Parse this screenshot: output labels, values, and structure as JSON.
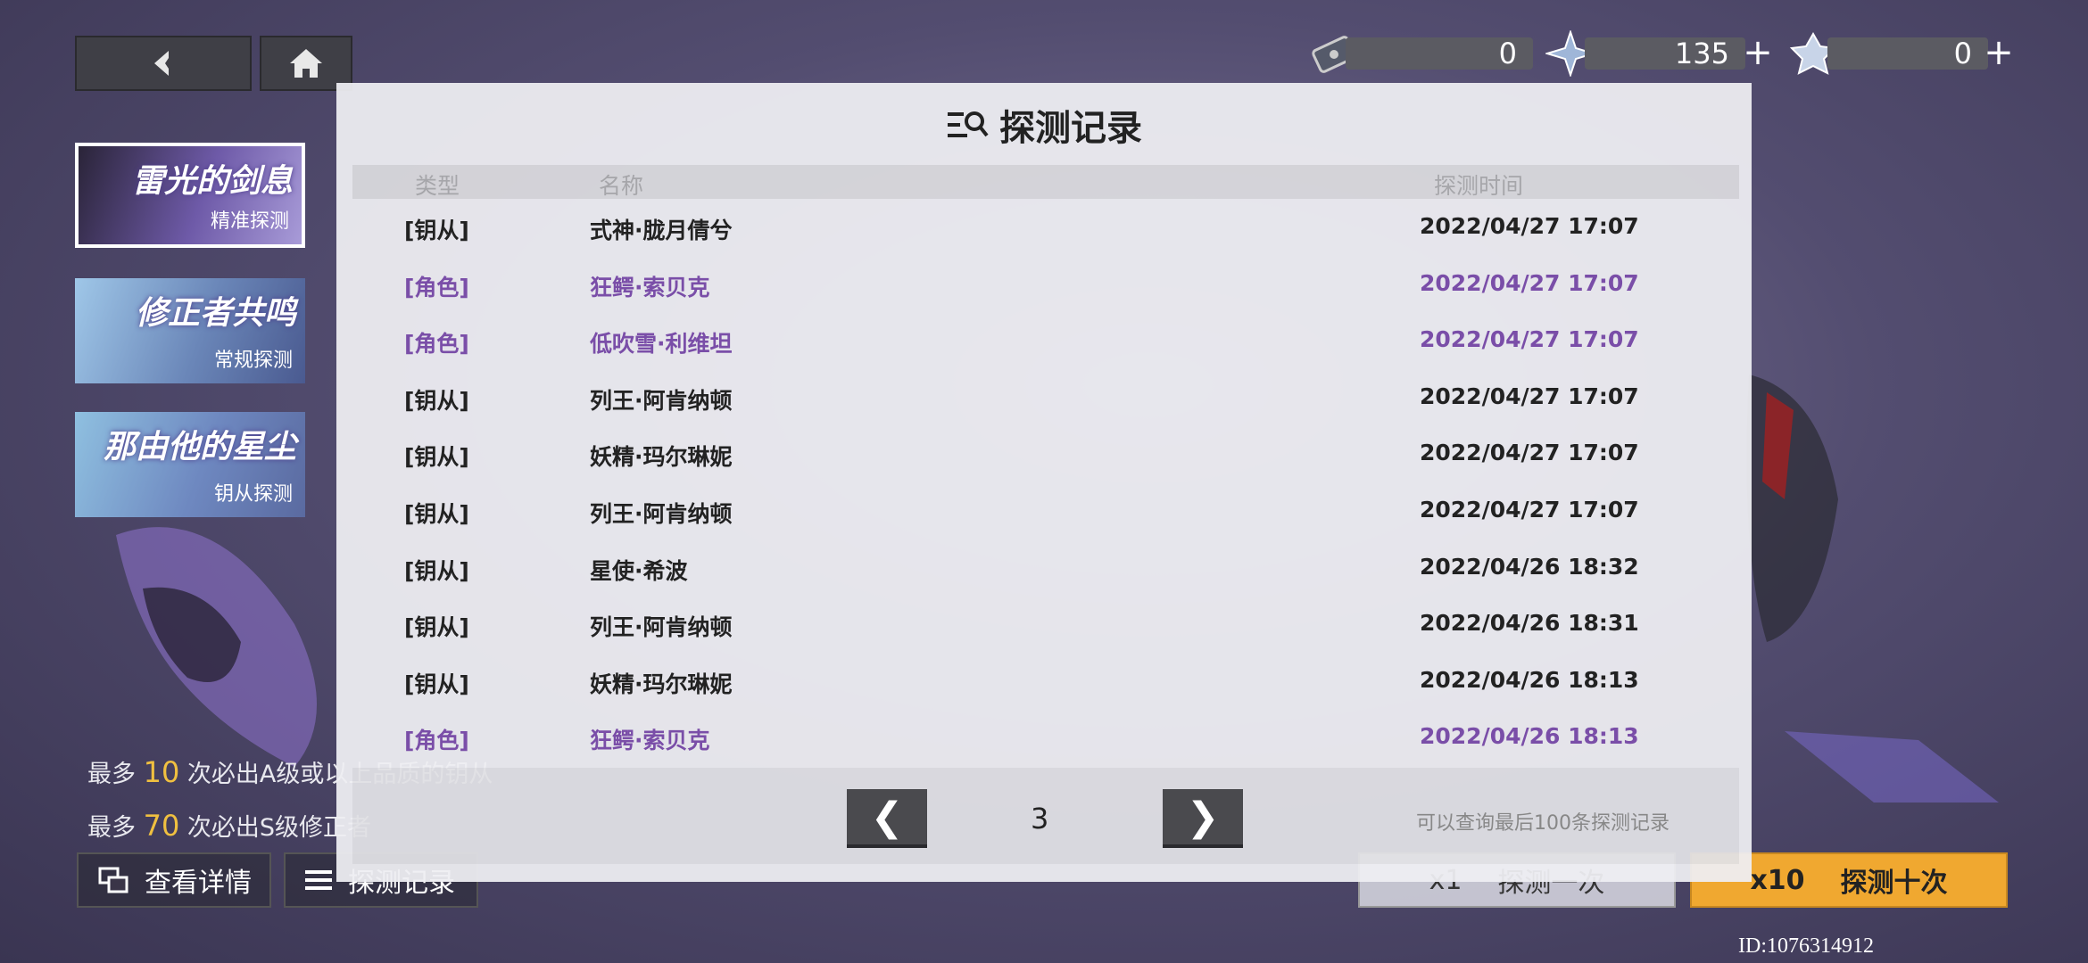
{
  "resources": [
    {
      "value": "0",
      "plus": ""
    },
    {
      "value": "135",
      "plus": "+"
    },
    {
      "value": "0",
      "plus": "+"
    }
  ],
  "banners": [
    {
      "title": "雷光的剑息",
      "subtitle": "精准探测"
    },
    {
      "title": "修正者共鸣",
      "subtitle": "常规探测"
    },
    {
      "title": "那由他的星尘",
      "subtitle": "钥从探测"
    }
  ],
  "footer": {
    "line1_prefix": "最多",
    "line1_num": "10",
    "line1_suffix": "次必出A级或以上品质的钥从",
    "line2_prefix": "最多",
    "line2_num": "70",
    "line2_suffix": "次必出S级修正者",
    "details_button": "查看详情",
    "records_button": "探测记录",
    "draw1_label": "探测一次",
    "draw1_count": "x1",
    "draw10_label": "探测十次",
    "draw10_count": "x10",
    "user_id": "ID:1076314912"
  },
  "modal": {
    "title": "探测记录",
    "col_type": "类型",
    "col_name": "名称",
    "col_time": "探测时间",
    "rows": [
      {
        "type": "[钥从]",
        "name": "式神·胧月倩兮",
        "time": "2022/04/27 17:07",
        "highlight": false
      },
      {
        "type": "[角色]",
        "name": "狂鳄·索贝克",
        "time": "2022/04/27 17:07",
        "highlight": true
      },
      {
        "type": "[角色]",
        "name": "低吹雪·利维坦",
        "time": "2022/04/27 17:07",
        "highlight": true
      },
      {
        "type": "[钥从]",
        "name": "列王·阿肯纳顿",
        "time": "2022/04/27 17:07",
        "highlight": false
      },
      {
        "type": "[钥从]",
        "name": "妖精·玛尔琳妮",
        "time": "2022/04/27 17:07",
        "highlight": false
      },
      {
        "type": "[钥从]",
        "name": "列王·阿肯纳顿",
        "time": "2022/04/27 17:07",
        "highlight": false
      },
      {
        "type": "[钥从]",
        "name": "星使·希波",
        "time": "2022/04/26 18:32",
        "highlight": false
      },
      {
        "type": "[钥从]",
        "name": "列王·阿肯纳顿",
        "time": "2022/04/26 18:31",
        "highlight": false
      },
      {
        "type": "[钥从]",
        "name": "妖精·玛尔琳妮",
        "time": "2022/04/26 18:13",
        "highlight": false
      },
      {
        "type": "[角色]",
        "name": "狂鳄·索贝克",
        "time": "2022/04/26 18:13",
        "highlight": true
      }
    ],
    "page": "3",
    "prev_glyph": "❮",
    "next_glyph": "❯",
    "note": "可以查询最后100条探测记录"
  },
  "colors": {
    "highlight": "#7a4ea8",
    "accent_gold": "#f0c040",
    "draw10_bg": "#f0a830"
  },
  "icons": [
    "back-arrow-icon",
    "home-icon",
    "ticket-icon",
    "crystal-icon",
    "gem-icon",
    "record-search-icon",
    "details-icon",
    "list-icon"
  ]
}
